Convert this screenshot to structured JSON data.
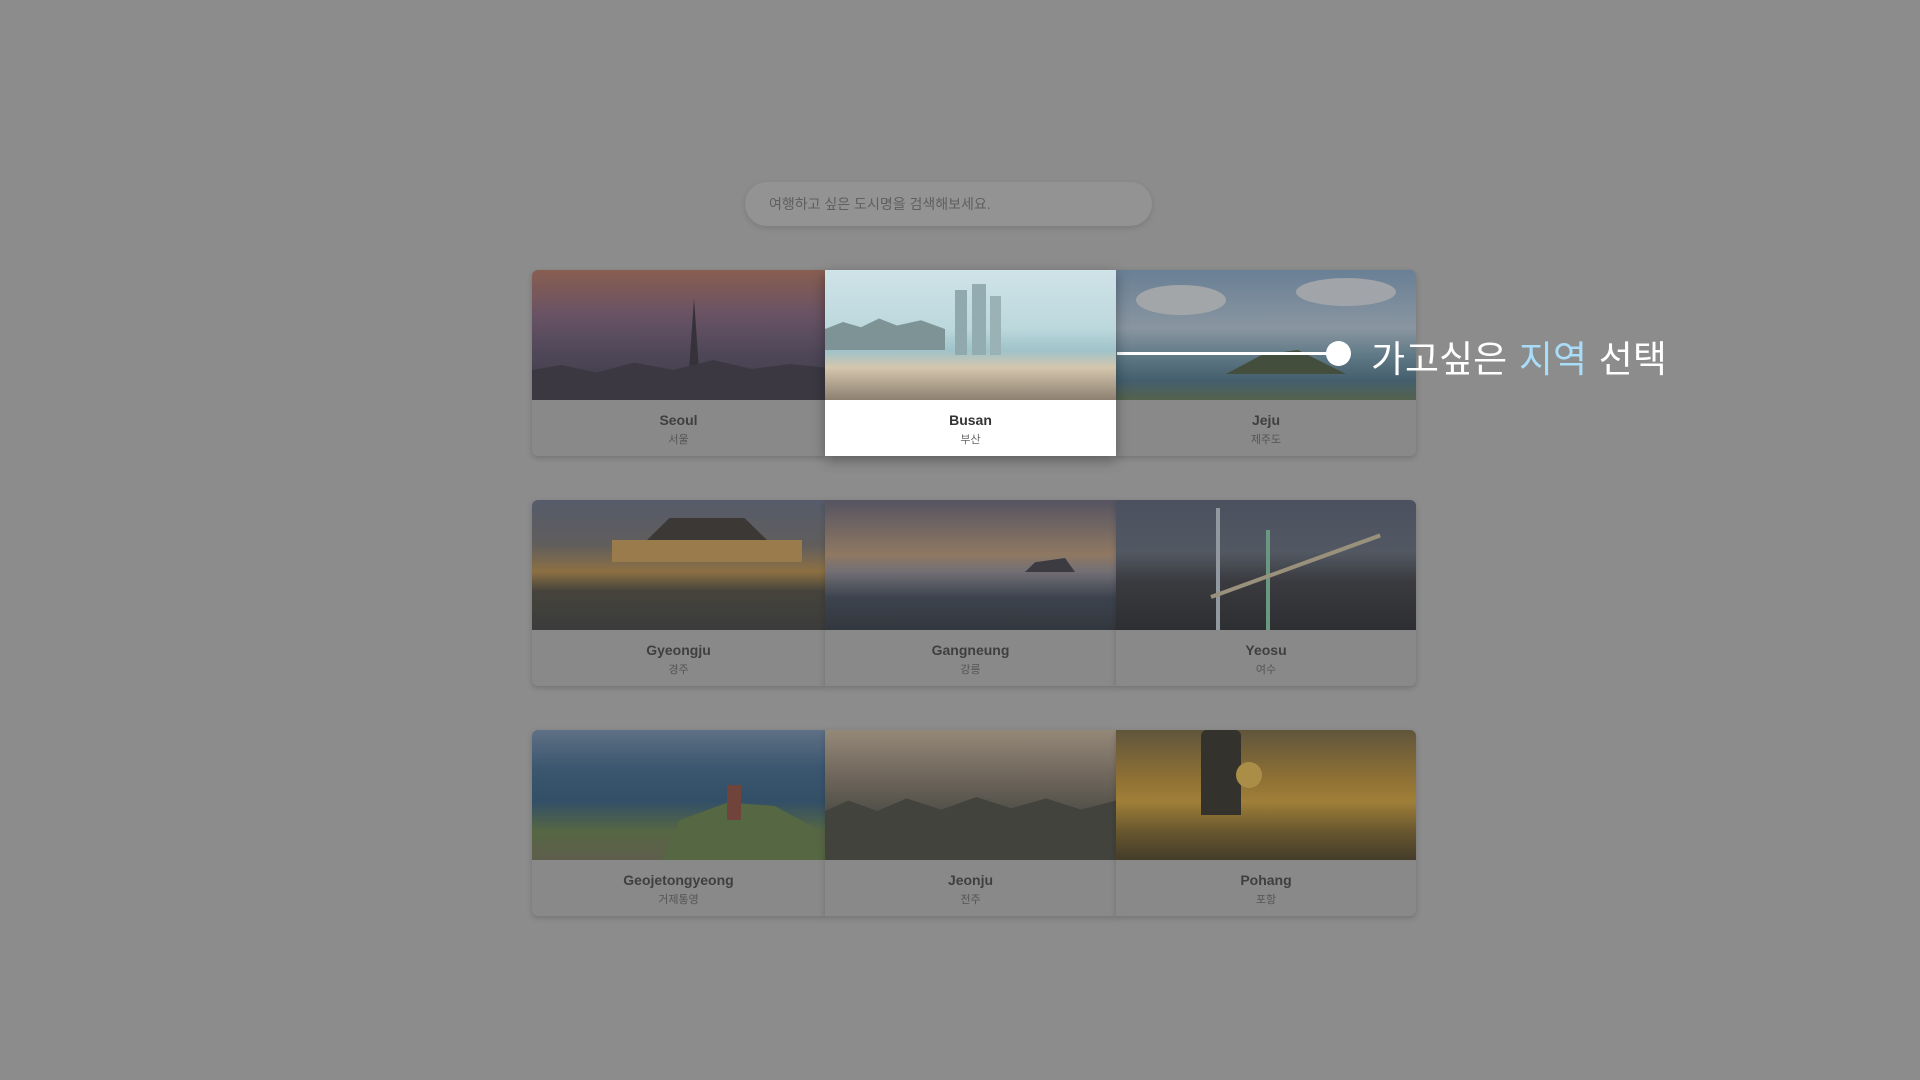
{
  "search": {
    "placeholder": "여행하고 싶은 도시명을 검색해보세요."
  },
  "cities": [
    {
      "en": "Seoul",
      "ko": "서울",
      "selected": false
    },
    {
      "en": "Busan",
      "ko": "부산",
      "selected": true
    },
    {
      "en": "Jeju",
      "ko": "제주도",
      "selected": false
    },
    {
      "en": "Gyeongju",
      "ko": "경주",
      "selected": false
    },
    {
      "en": "Gangneung",
      "ko": "강릉",
      "selected": false
    },
    {
      "en": "Yeosu",
      "ko": "여수",
      "selected": false
    },
    {
      "en": "Geojetongyeong",
      "ko": "거제통영",
      "selected": false
    },
    {
      "en": "Jeonju",
      "ko": "전주",
      "selected": false
    },
    {
      "en": "Pohang",
      "ko": "포항",
      "selected": false
    }
  ],
  "callout": {
    "prefix": "가고싶은 ",
    "highlight": "지역",
    "suffix": " 선택",
    "highlight_color": "#a9dcf7"
  }
}
